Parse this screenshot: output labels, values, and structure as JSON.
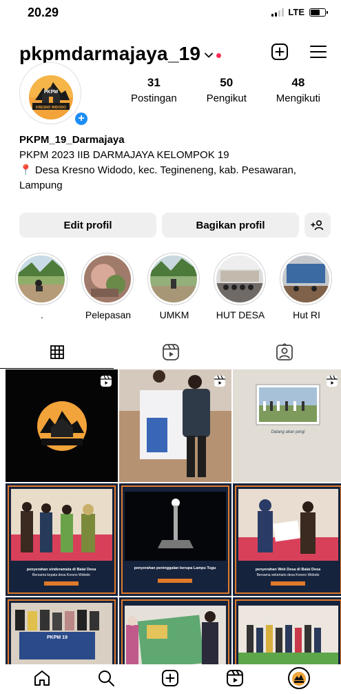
{
  "status_bar": {
    "time": "20.29",
    "network": "LTE"
  },
  "header": {
    "username": "pkpmdarmajaya_19"
  },
  "avatar": {
    "logo_top": "PKPM",
    "logo_bottom": "KRESNO WIDODO"
  },
  "stats": [
    {
      "value": "31",
      "label": "Postingan"
    },
    {
      "value": "50",
      "label": "Pengikut"
    },
    {
      "value": "48",
      "label": "Mengikuti"
    }
  ],
  "bio": {
    "name": "PKPM_19_Darmajaya",
    "line1": "PKPM 2023 IIB DARMAJAYA KELOMPOK 19",
    "location": "Desa Kresno Widodo, kec. Tegineneng, kab. Pesawaran, Lampung"
  },
  "buttons": {
    "edit": "Edit profil",
    "share": "Bagikan profil"
  },
  "highlights": [
    {
      "label": "."
    },
    {
      "label": "Pelepasan"
    },
    {
      "label": "UMKM"
    },
    {
      "label": "HUT DESA"
    },
    {
      "label": "Hut RI"
    }
  ],
  "posts": {
    "p3_caption": "Datang akan pergi",
    "p4_caption": "penyerahan sinderamata di Balai Desa",
    "p4_sub": "Bersama kepala desa Kresno Widodo",
    "p5_caption": "penyerahan peninggalan berupa Lampu Tugu",
    "p6_caption": "penyerahan Web Desa di Balai Desa",
    "p6_sub": "Bersama sekertaris desa Kresno Widodo",
    "banner": "PKPM 19"
  },
  "colors": {
    "accent_blue": "#1d8ef5",
    "notification_red": "#ff2d55",
    "button_gray": "#efefef"
  }
}
